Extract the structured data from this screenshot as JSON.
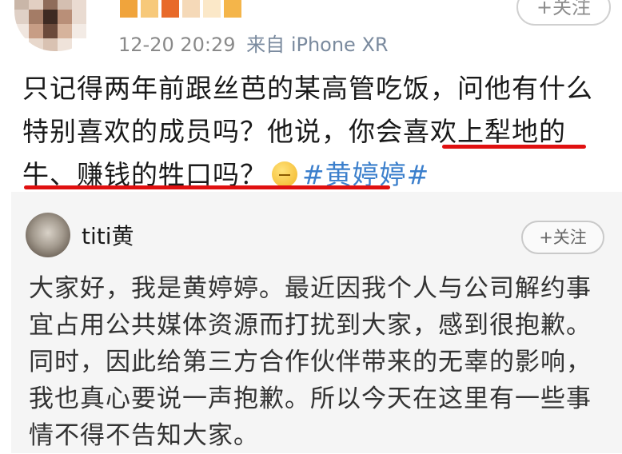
{
  "post": {
    "timestamp": "12-20 20:29",
    "source_prefix": "来自",
    "source_device": "iPhone XR",
    "follow_label": "+关注",
    "text_part1": "只记得两年前跟丝芭的某高管吃饭，问他有什么特别喜欢的成员吗？他说，",
    "text_highlight_a": "你会喜欢上",
    "text_highlight_b": "犁地的牛、赚钱的牲口吗？",
    "hashtag": "#黄婷婷#",
    "emoji_icon": "thinking-face-icon",
    "underline_color": "#e01010"
  },
  "quoted": {
    "username": "titi黄",
    "follow_label": "+关注",
    "text": "大家好，我是黄婷婷。最近因我个人与公司解约事宜占用公共媒体资源而打扰到大家，感到很抱歉。同时，因此给第三方合作伙伴带来的无辜的影响，我也真心要说一声抱歉。所以今天在这里有一些事情不得不告知大家。"
  },
  "colors": {
    "link": "#3b7fcc",
    "meta": "#8a8a8a",
    "card_bg": "#f5f5f5"
  }
}
